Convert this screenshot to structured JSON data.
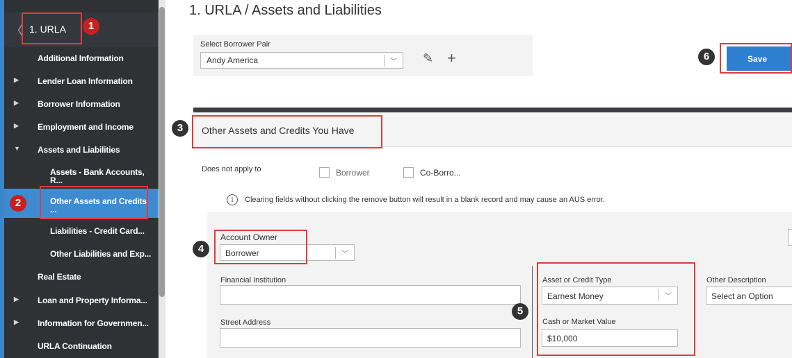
{
  "sidebar": {
    "header_title": "1. URLA",
    "items": [
      {
        "label": "Additional Information"
      },
      {
        "label": "Lender Loan Information"
      },
      {
        "label": "Borrower Information"
      },
      {
        "label": "Employment and Income"
      },
      {
        "label": "Assets and Liabilities"
      },
      {
        "label": "Assets - Bank Accounts,",
        "label2": "R..."
      },
      {
        "label": "Other Assets and Credits",
        "label2": "..."
      },
      {
        "label": "Liabilities - Credit Card..."
      },
      {
        "label": "Other Liabilities and Exp..."
      },
      {
        "label": "Real Estate"
      },
      {
        "label": "Loan and Property Informa..."
      },
      {
        "label": "Information for Governmen..."
      },
      {
        "label": "URLA Continuation"
      }
    ]
  },
  "main": {
    "title": "1. URLA / Assets and Liabilities",
    "pair": {
      "label": "Select Borrower Pair",
      "value": "Andy America"
    },
    "save_label": "Save",
    "section_title": "Other Assets and Credits You Have",
    "does_not_apply": {
      "label": "Does not apply to",
      "borrower": "Borrower",
      "coborrower": "Co-Borro..."
    },
    "warning": "Clearing fields without clicking the remove button will result in a blank record and may cause an AUS error.",
    "form": {
      "account_owner": {
        "label": "Account Owner",
        "value": "Borrower"
      },
      "financial_institution": {
        "label": "Financial Institution",
        "value": ""
      },
      "street_address": {
        "label": "Street Address",
        "value": ""
      },
      "asset_type": {
        "label": "Asset or Credit Type",
        "value": "Earnest Money"
      },
      "cash_value": {
        "label": "Cash or Market Value",
        "value": "$10,000"
      },
      "other_description": {
        "label": "Other Description",
        "value": "Select an Option"
      }
    }
  },
  "annotations": {
    "badges": [
      "1",
      "2",
      "3",
      "4",
      "5",
      "6"
    ],
    "color": "#e03c3c"
  }
}
